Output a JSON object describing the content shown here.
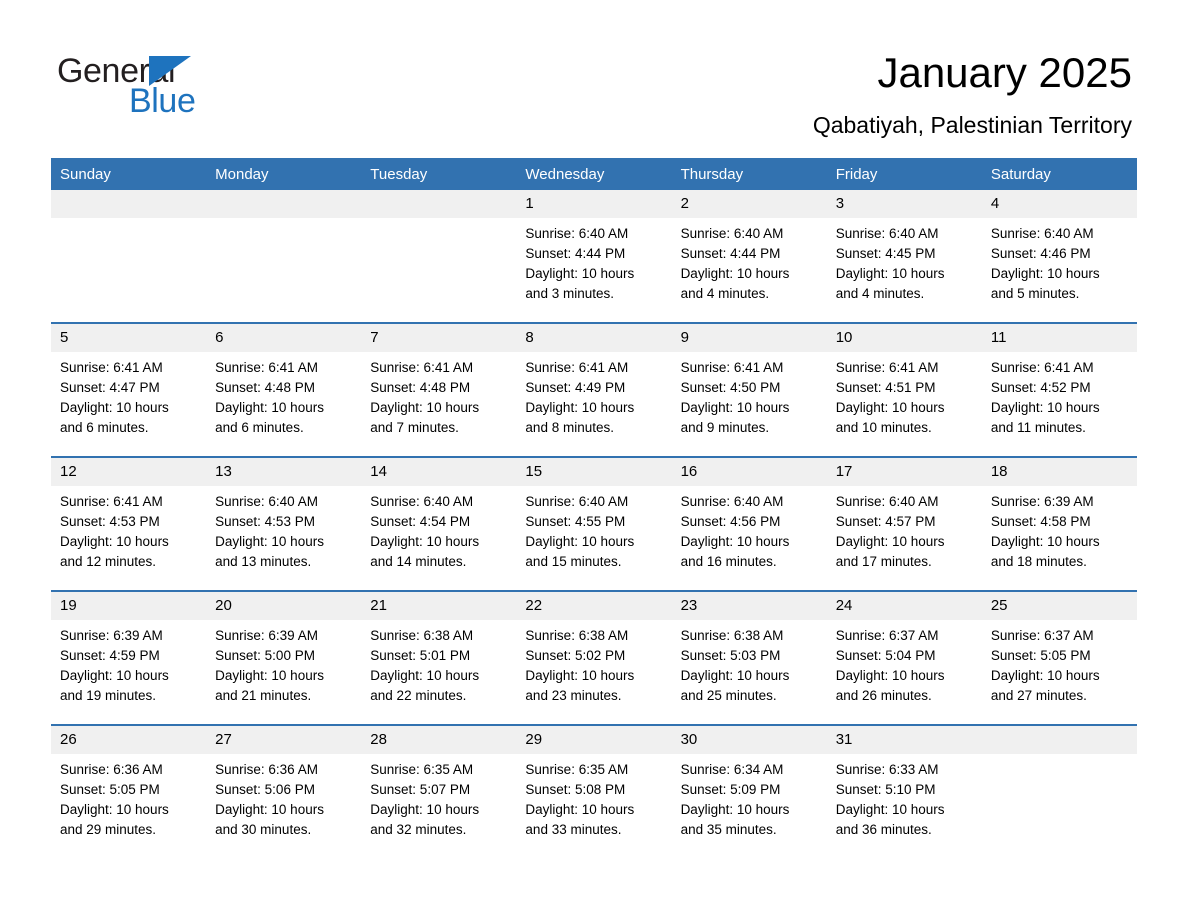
{
  "brand": {
    "name_part1": "General",
    "name_part2": "Blue",
    "accent_color": "#1e73be"
  },
  "header": {
    "month_title": "January 2025",
    "location": "Qabatiyah, Palestinian Territory",
    "header_bg_color": "#3272b0"
  },
  "weekdays": [
    "Sunday",
    "Monday",
    "Tuesday",
    "Wednesday",
    "Thursday",
    "Friday",
    "Saturday"
  ],
  "weeks": [
    [
      {
        "day": "",
        "lines": []
      },
      {
        "day": "",
        "lines": []
      },
      {
        "day": "",
        "lines": []
      },
      {
        "day": "1",
        "lines": [
          "Sunrise: 6:40 AM",
          "Sunset: 4:44 PM",
          "Daylight: 10 hours",
          "and 3 minutes."
        ]
      },
      {
        "day": "2",
        "lines": [
          "Sunrise: 6:40 AM",
          "Sunset: 4:44 PM",
          "Daylight: 10 hours",
          "and 4 minutes."
        ]
      },
      {
        "day": "3",
        "lines": [
          "Sunrise: 6:40 AM",
          "Sunset: 4:45 PM",
          "Daylight: 10 hours",
          "and 4 minutes."
        ]
      },
      {
        "day": "4",
        "lines": [
          "Sunrise: 6:40 AM",
          "Sunset: 4:46 PM",
          "Daylight: 10 hours",
          "and 5 minutes."
        ]
      }
    ],
    [
      {
        "day": "5",
        "lines": [
          "Sunrise: 6:41 AM",
          "Sunset: 4:47 PM",
          "Daylight: 10 hours",
          "and 6 minutes."
        ]
      },
      {
        "day": "6",
        "lines": [
          "Sunrise: 6:41 AM",
          "Sunset: 4:48 PM",
          "Daylight: 10 hours",
          "and 6 minutes."
        ]
      },
      {
        "day": "7",
        "lines": [
          "Sunrise: 6:41 AM",
          "Sunset: 4:48 PM",
          "Daylight: 10 hours",
          "and 7 minutes."
        ]
      },
      {
        "day": "8",
        "lines": [
          "Sunrise: 6:41 AM",
          "Sunset: 4:49 PM",
          "Daylight: 10 hours",
          "and 8 minutes."
        ]
      },
      {
        "day": "9",
        "lines": [
          "Sunrise: 6:41 AM",
          "Sunset: 4:50 PM",
          "Daylight: 10 hours",
          "and 9 minutes."
        ]
      },
      {
        "day": "10",
        "lines": [
          "Sunrise: 6:41 AM",
          "Sunset: 4:51 PM",
          "Daylight: 10 hours",
          "and 10 minutes."
        ]
      },
      {
        "day": "11",
        "lines": [
          "Sunrise: 6:41 AM",
          "Sunset: 4:52 PM",
          "Daylight: 10 hours",
          "and 11 minutes."
        ]
      }
    ],
    [
      {
        "day": "12",
        "lines": [
          "Sunrise: 6:41 AM",
          "Sunset: 4:53 PM",
          "Daylight: 10 hours",
          "and 12 minutes."
        ]
      },
      {
        "day": "13",
        "lines": [
          "Sunrise: 6:40 AM",
          "Sunset: 4:53 PM",
          "Daylight: 10 hours",
          "and 13 minutes."
        ]
      },
      {
        "day": "14",
        "lines": [
          "Sunrise: 6:40 AM",
          "Sunset: 4:54 PM",
          "Daylight: 10 hours",
          "and 14 minutes."
        ]
      },
      {
        "day": "15",
        "lines": [
          "Sunrise: 6:40 AM",
          "Sunset: 4:55 PM",
          "Daylight: 10 hours",
          "and 15 minutes."
        ]
      },
      {
        "day": "16",
        "lines": [
          "Sunrise: 6:40 AM",
          "Sunset: 4:56 PM",
          "Daylight: 10 hours",
          "and 16 minutes."
        ]
      },
      {
        "day": "17",
        "lines": [
          "Sunrise: 6:40 AM",
          "Sunset: 4:57 PM",
          "Daylight: 10 hours",
          "and 17 minutes."
        ]
      },
      {
        "day": "18",
        "lines": [
          "Sunrise: 6:39 AM",
          "Sunset: 4:58 PM",
          "Daylight: 10 hours",
          "and 18 minutes."
        ]
      }
    ],
    [
      {
        "day": "19",
        "lines": [
          "Sunrise: 6:39 AM",
          "Sunset: 4:59 PM",
          "Daylight: 10 hours",
          "and 19 minutes."
        ]
      },
      {
        "day": "20",
        "lines": [
          "Sunrise: 6:39 AM",
          "Sunset: 5:00 PM",
          "Daylight: 10 hours",
          "and 21 minutes."
        ]
      },
      {
        "day": "21",
        "lines": [
          "Sunrise: 6:38 AM",
          "Sunset: 5:01 PM",
          "Daylight: 10 hours",
          "and 22 minutes."
        ]
      },
      {
        "day": "22",
        "lines": [
          "Sunrise: 6:38 AM",
          "Sunset: 5:02 PM",
          "Daylight: 10 hours",
          "and 23 minutes."
        ]
      },
      {
        "day": "23",
        "lines": [
          "Sunrise: 6:38 AM",
          "Sunset: 5:03 PM",
          "Daylight: 10 hours",
          "and 25 minutes."
        ]
      },
      {
        "day": "24",
        "lines": [
          "Sunrise: 6:37 AM",
          "Sunset: 5:04 PM",
          "Daylight: 10 hours",
          "and 26 minutes."
        ]
      },
      {
        "day": "25",
        "lines": [
          "Sunrise: 6:37 AM",
          "Sunset: 5:05 PM",
          "Daylight: 10 hours",
          "and 27 minutes."
        ]
      }
    ],
    [
      {
        "day": "26",
        "lines": [
          "Sunrise: 6:36 AM",
          "Sunset: 5:05 PM",
          "Daylight: 10 hours",
          "and 29 minutes."
        ]
      },
      {
        "day": "27",
        "lines": [
          "Sunrise: 6:36 AM",
          "Sunset: 5:06 PM",
          "Daylight: 10 hours",
          "and 30 minutes."
        ]
      },
      {
        "day": "28",
        "lines": [
          "Sunrise: 6:35 AM",
          "Sunset: 5:07 PM",
          "Daylight: 10 hours",
          "and 32 minutes."
        ]
      },
      {
        "day": "29",
        "lines": [
          "Sunrise: 6:35 AM",
          "Sunset: 5:08 PM",
          "Daylight: 10 hours",
          "and 33 minutes."
        ]
      },
      {
        "day": "30",
        "lines": [
          "Sunrise: 6:34 AM",
          "Sunset: 5:09 PM",
          "Daylight: 10 hours",
          "and 35 minutes."
        ]
      },
      {
        "day": "31",
        "lines": [
          "Sunrise: 6:33 AM",
          "Sunset: 5:10 PM",
          "Daylight: 10 hours",
          "and 36 minutes."
        ]
      },
      {
        "day": "",
        "lines": []
      }
    ]
  ]
}
